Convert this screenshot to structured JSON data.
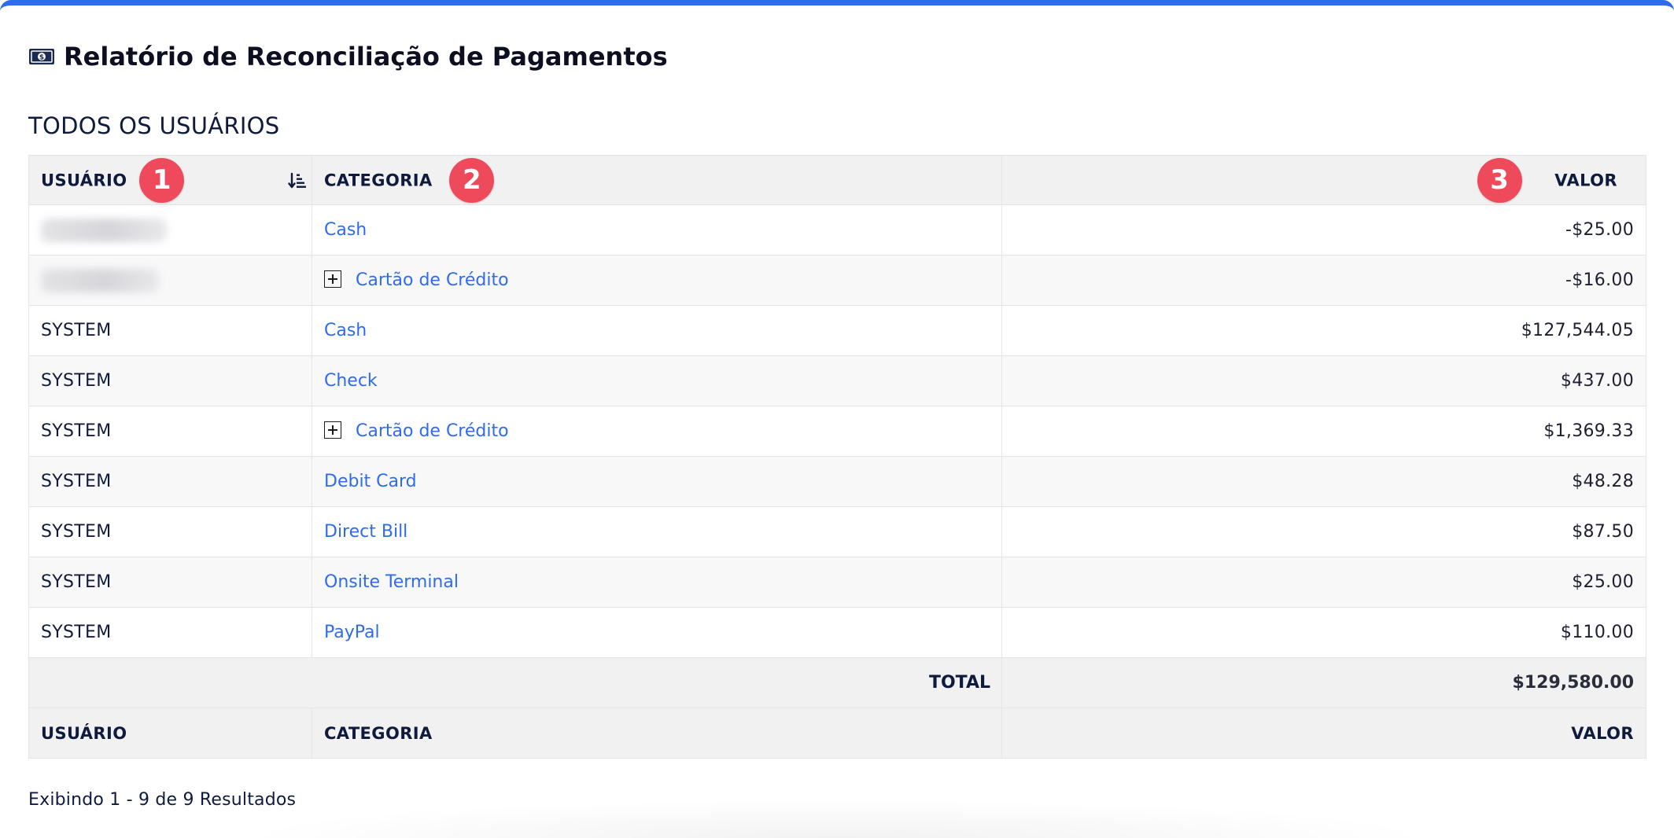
{
  "page": {
    "title": "Relatório de Reconciliação de Pagamentos",
    "section_title": "TODOS OS USUÁRIOS",
    "results_text": "Exibindo 1 - 9 de 9 Resultados",
    "accent_color": "#2f6bef",
    "badge_color": "#ef4a5c",
    "link_color": "#2f6bef"
  },
  "table": {
    "headers": {
      "user": "USUÁRIO",
      "category": "CATEGORIA",
      "value": "VALOR"
    },
    "badges": {
      "user": "1",
      "category": "2",
      "value": "3"
    },
    "rows": [
      {
        "user": "",
        "user_redacted": true,
        "category": "Cash",
        "expandable": false,
        "value": "-$25.00"
      },
      {
        "user": "",
        "user_redacted": true,
        "category": "Cartão de Crédito",
        "expandable": true,
        "value": "-$16.00"
      },
      {
        "user": "SYSTEM",
        "user_redacted": false,
        "category": "Cash",
        "expandable": false,
        "value": "$127,544.05"
      },
      {
        "user": "SYSTEM",
        "user_redacted": false,
        "category": "Check",
        "expandable": false,
        "value": "$437.00"
      },
      {
        "user": "SYSTEM",
        "user_redacted": false,
        "category": "Cartão de Crédito",
        "expandable": true,
        "value": "$1,369.33"
      },
      {
        "user": "SYSTEM",
        "user_redacted": false,
        "category": "Debit Card",
        "expandable": false,
        "value": "$48.28"
      },
      {
        "user": "SYSTEM",
        "user_redacted": false,
        "category": "Direct Bill",
        "expandable": false,
        "value": "$87.50"
      },
      {
        "user": "SYSTEM",
        "user_redacted": false,
        "category": "Onsite Terminal",
        "expandable": false,
        "value": "$25.00"
      },
      {
        "user": "SYSTEM",
        "user_redacted": false,
        "category": "PayPal",
        "expandable": false,
        "value": "$110.00"
      }
    ],
    "total": {
      "label": "TOTAL",
      "value": "$129,580.00"
    },
    "footer": {
      "user": "USUÁRIO",
      "category": "CATEGORIA",
      "value": "VALOR"
    }
  },
  "icons": {
    "title": "money-bill-icon",
    "sort": "sort-ascending-icon",
    "expand": "plus-square-icon"
  }
}
